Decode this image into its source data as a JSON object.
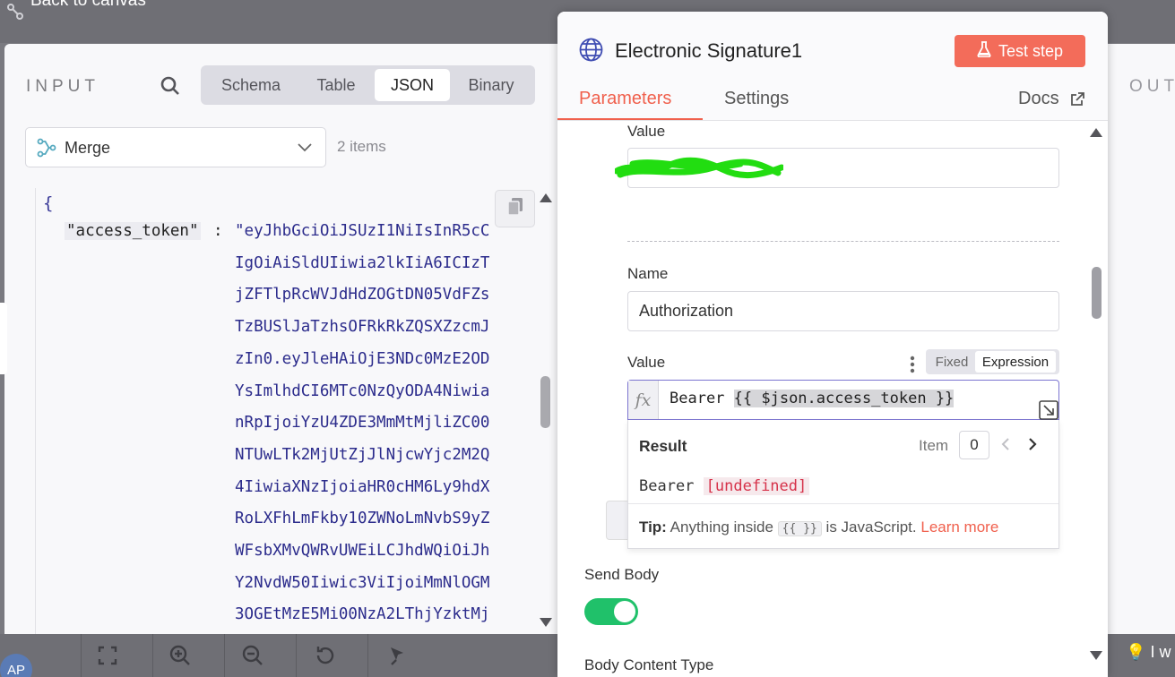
{
  "canvas": {
    "back_label": "Back to canvas",
    "avatar_initials": "AP",
    "hint_text": "I w"
  },
  "input_panel": {
    "title": "INPUT",
    "tabs": [
      "Schema",
      "Table",
      "JSON",
      "Binary"
    ],
    "active_tab": "JSON",
    "node_select": "Merge",
    "items_count": "2 items",
    "json": {
      "open_brace": "{",
      "key": "\"access_token\"",
      "colon": ":",
      "value_lines": [
        "\"eyJhbGciOiJSUzI1NiIsInR5cC",
        "IgOiAiSldUIiwia2lkIiA6ICIzT",
        "jZFTlpRcWVJdHdZOGtDN05VdFZs",
        "TzBUSlJaTzhsOFRkRkZQSXZzcmJ",
        "zIn0.eyJleHAiOjE3NDc0MzE2OD",
        "YsImlhdCI6MTc0NzQyODA4Niwia",
        "nRpIjoiYzU4ZDE3MmMtMjliZC00",
        "NTUwLTk2MjUtZjJlNjcwYjc2M2Q",
        "4IiwiaXNzIjoiaHR0cHM6Ly9hdX",
        "RoLXFhLmFkby10ZWNoLmNvbS9yZ",
        "WFsbXMvQWRvUWEiLCJhdWQiOiJh",
        "Y2NvdW50Iiwic3ViIjoiMmNlOGM",
        "3OGEtMzE5Mi00NzA2LThjYzktMj"
      ]
    }
  },
  "output_panel": {
    "title": "OUT"
  },
  "node_panel": {
    "title": "Electronic Signature1",
    "test_button": "Test step",
    "tabs": [
      "Parameters",
      "Settings"
    ],
    "docs_label": "Docs",
    "fields": {
      "value_label_1": "Value",
      "name_label": "Name",
      "name_value": "Authorization",
      "value_label_2": "Value",
      "mode_fixed": "Fixed",
      "mode_expression": "Expression",
      "fx": "fx",
      "expr_prefix": "Bearer ",
      "expr_highlight": "{{ $json.access_token }}"
    },
    "result": {
      "label": "Result",
      "item_label": "Item",
      "item_index": "0",
      "value_prefix": "Bearer ",
      "value_undefined": "[undefined]",
      "tip_label": "Tip:",
      "tip_text": " Anything inside ",
      "tip_code": "{{ }}",
      "tip_text2": " is JavaScript. ",
      "tip_link": "Learn more"
    },
    "send_body_label": "Send Body",
    "send_body_on": true,
    "body_type_label": "Body Content Type"
  },
  "colors": {
    "accent": "#f0604d",
    "toggle_on": "#20c16a",
    "json_value": "#2c2c8c",
    "undefined": "#d6324a",
    "redaction": "#22dd11"
  }
}
